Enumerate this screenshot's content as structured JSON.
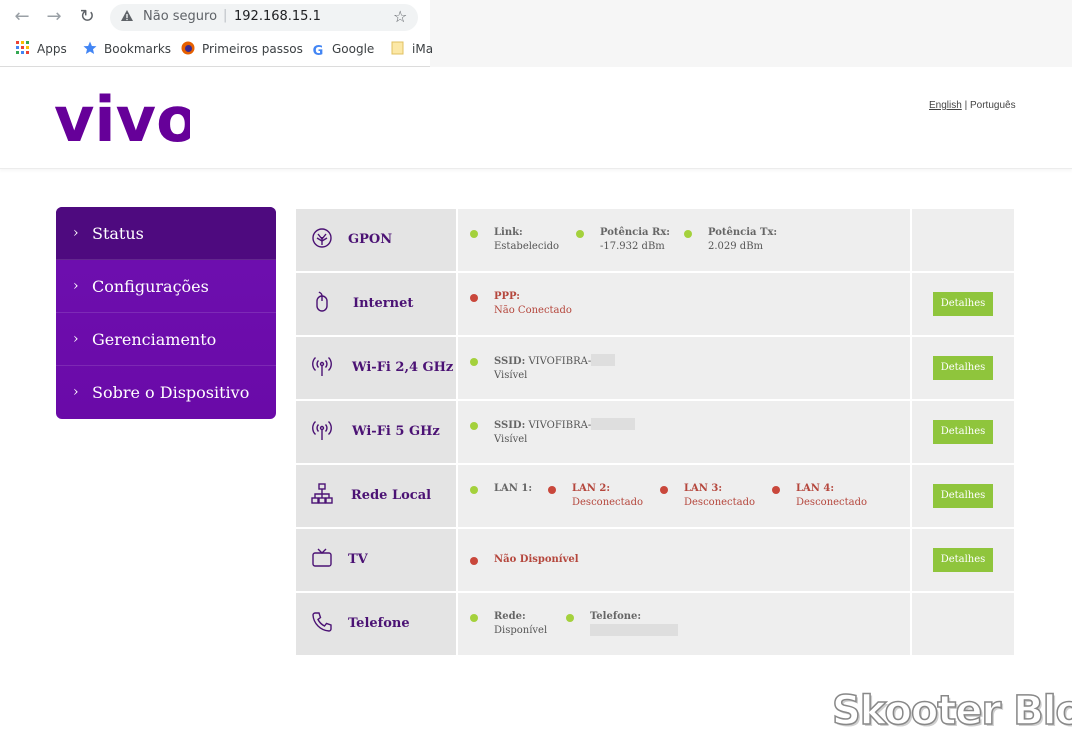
{
  "browser": {
    "omnibox": {
      "security_label": "Não seguro",
      "url": "192.168.15.1"
    },
    "bookmarks": [
      "Apps",
      "Bookmarks",
      "Primeiros passos",
      "Google",
      "iMa"
    ]
  },
  "header": {
    "logo_text": "vivo",
    "lang_english": "English",
    "lang_separator": "|",
    "lang_portuguese": "Português",
    "brand_color": "#660099"
  },
  "sidebar": {
    "items": [
      {
        "label": "Status",
        "active": true
      },
      {
        "label": "Configurações",
        "active": false
      },
      {
        "label": "Gerenciamento",
        "active": false
      },
      {
        "label": "Sobre o Dispositivo",
        "active": false
      }
    ]
  },
  "status_table": {
    "details_label": "Detalhes",
    "rows": [
      {
        "name": "GPON",
        "icon": "gpon-icon",
        "items": [
          {
            "label": "Link:",
            "value": "Estabelecido",
            "state": "ok"
          },
          {
            "label": "Potência Rx:",
            "value": "-17.932 dBm",
            "state": "ok"
          },
          {
            "label": "Potência Tx:",
            "value": "2.029 dBm",
            "state": "ok"
          }
        ]
      },
      {
        "name": "Internet",
        "icon": "mouse-icon",
        "items": [
          {
            "label": "PPP:",
            "value": "Não Conectado",
            "state": "error"
          }
        ]
      },
      {
        "name": "Wi-Fi 2,4 GHz",
        "icon": "wifi-antenna-icon",
        "items": [
          {
            "label": "SSID:",
            "value": "VIVOFIBRA-",
            "value2": "Visível",
            "state": "ok"
          }
        ]
      },
      {
        "name": "Wi-Fi 5 GHz",
        "icon": "wifi-antenna-icon",
        "items": [
          {
            "label": "SSID:",
            "value": "VIVOFIBRA-",
            "value2": "Visível",
            "state": "ok"
          }
        ]
      },
      {
        "name": "Rede Local",
        "icon": "network-icon",
        "items": [
          {
            "label": "LAN 1:",
            "value": "",
            "state": "ok"
          },
          {
            "label": "LAN 2:",
            "value": "Desconectado",
            "state": "error"
          },
          {
            "label": "LAN 3:",
            "value": "Desconectado",
            "state": "error"
          },
          {
            "label": "LAN 4:",
            "value": "Desconectado",
            "state": "error"
          }
        ]
      },
      {
        "name": "TV",
        "icon": "tv-icon",
        "items": [
          {
            "label": "Não Disponível",
            "value": "",
            "state": "error"
          }
        ]
      },
      {
        "name": "Telefone",
        "icon": "phone-icon",
        "items": [
          {
            "label": "Rede:",
            "value": "Disponível",
            "state": "ok"
          },
          {
            "label": "Telefone:",
            "value": "",
            "state": "ok"
          }
        ]
      }
    ]
  },
  "watermark": "Skooter Blog",
  "colors": {
    "ok": "#a4d13c",
    "error": "#c9473b",
    "button": "#8fc53c",
    "menu": "#6a0dad",
    "menu_active": "#4e0a7f"
  }
}
